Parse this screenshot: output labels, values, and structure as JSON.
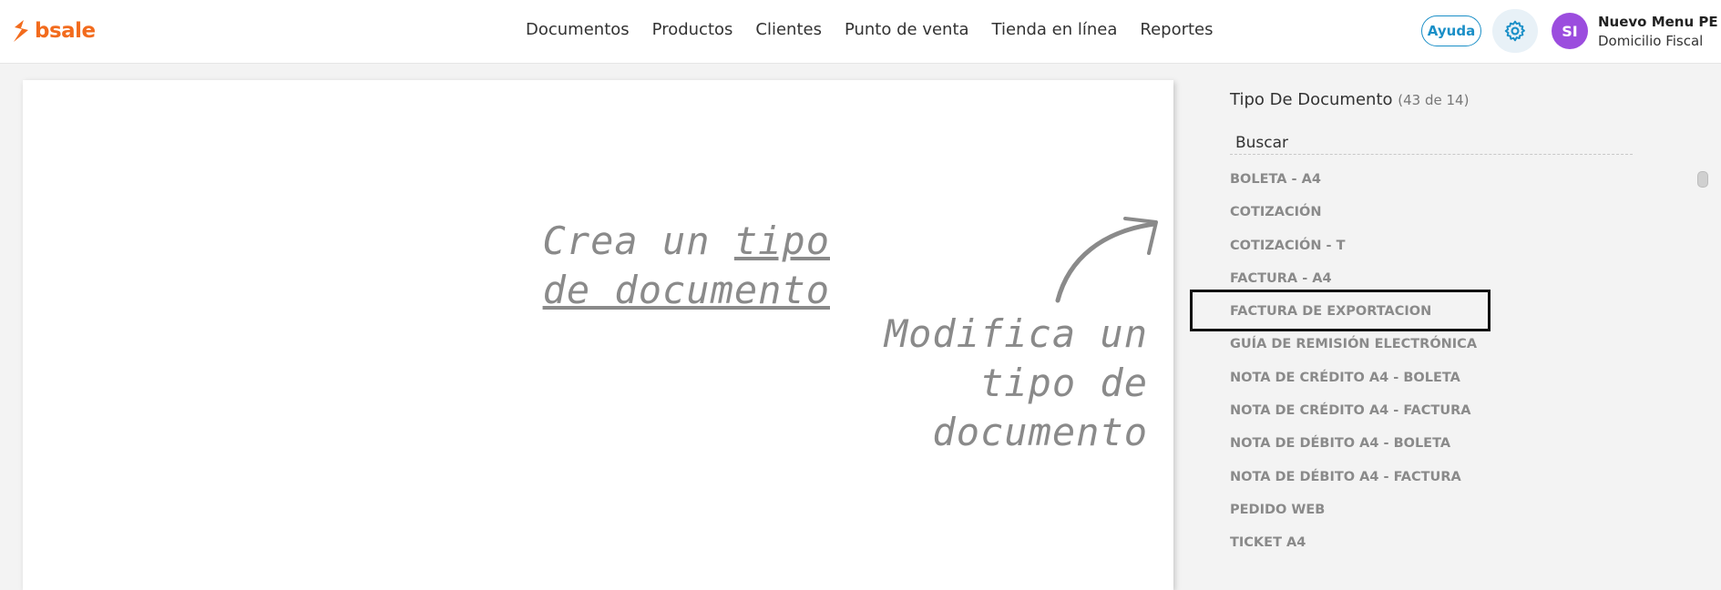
{
  "brand": {
    "logo_text": "bsale",
    "logo_color": "#f26b1d"
  },
  "nav": {
    "items": [
      {
        "label": "Documentos"
      },
      {
        "label": "Productos"
      },
      {
        "label": "Clientes"
      },
      {
        "label": "Punto de venta"
      },
      {
        "label": "Tienda en línea"
      },
      {
        "label": "Reportes"
      }
    ]
  },
  "header": {
    "help_label": "Ayuda",
    "settings_icon": "gear-icon",
    "avatar_initials": "SI",
    "user_name": "Nuevo Menu PE",
    "user_subtitle": "Domicilio Fiscal"
  },
  "canvas": {
    "create_hint_prefix": "Crea un ",
    "create_hint_link": "tipo de documento",
    "modify_hint": "Modifica un tipo de documento"
  },
  "panel": {
    "title": "Tipo De Documento",
    "count": "(43 de 14)",
    "search_placeholder": "Buscar",
    "items": [
      {
        "label": "BOLETA - A4"
      },
      {
        "label": "COTIZACIÓN"
      },
      {
        "label": "COTIZACIÓN - T"
      },
      {
        "label": "FACTURA - A4"
      },
      {
        "label": "FACTURA DE EXPORTACION"
      },
      {
        "label": "GUÍA DE REMISIÓN ELECTRÓNICA"
      },
      {
        "label": "NOTA DE CRÉDITO A4 - BOLETA"
      },
      {
        "label": "NOTA DE CRÉDITO A4 - FACTURA"
      },
      {
        "label": "NOTA DE DÉBITO A4 - BOLETA"
      },
      {
        "label": "NOTA DE DÉBITO A4 - FACTURA"
      },
      {
        "label": "PEDIDO WEB"
      },
      {
        "label": "TICKET A4"
      }
    ],
    "highlighted_item": "FACTURA DE EXPORTACION"
  }
}
